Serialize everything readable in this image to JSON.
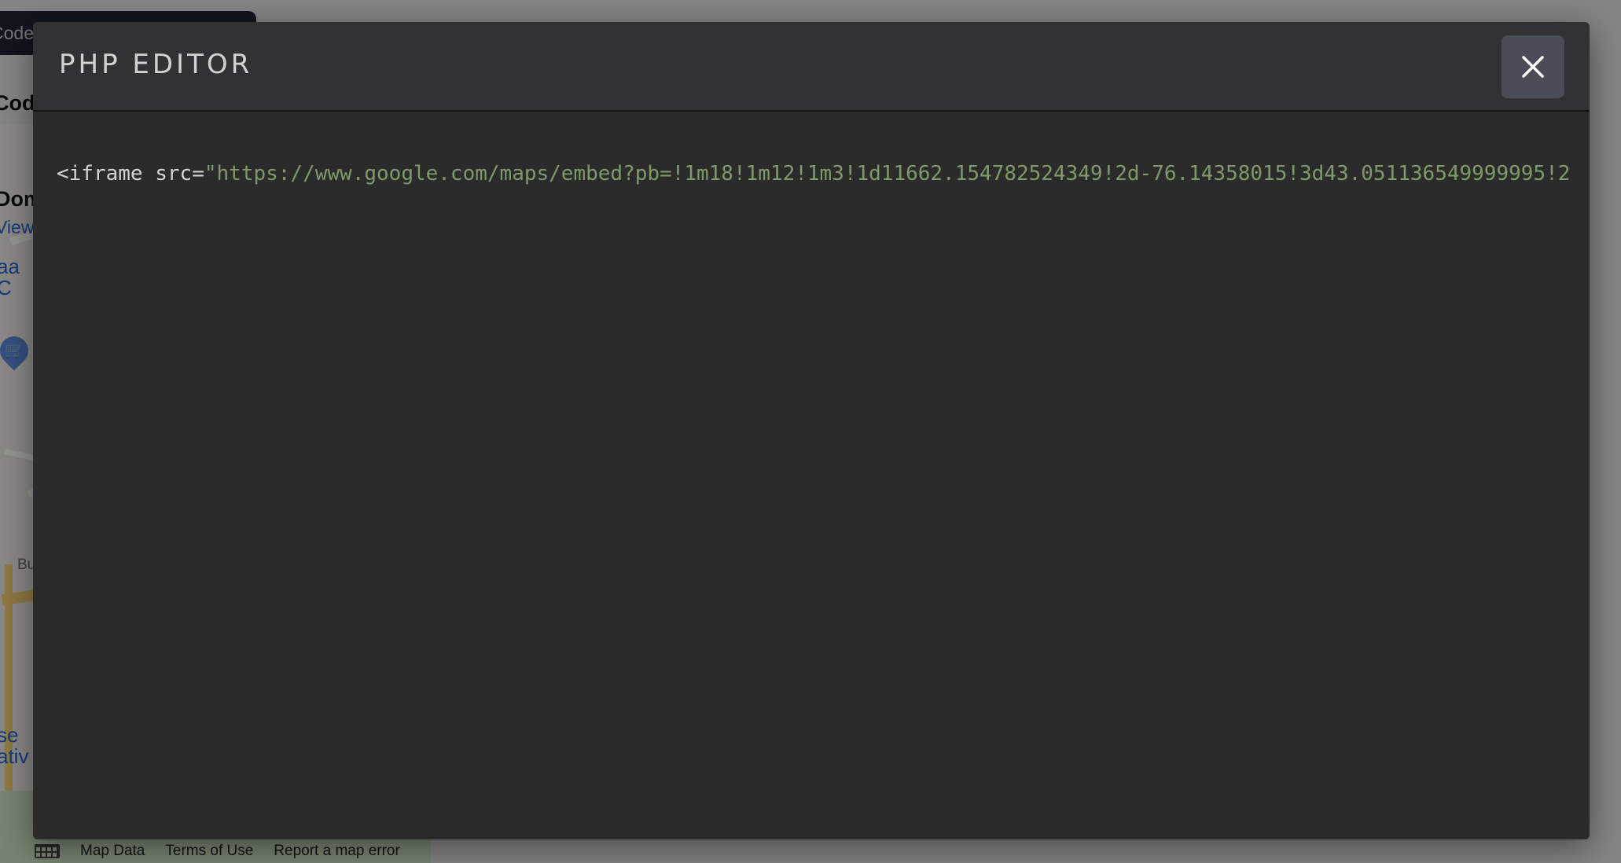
{
  "background": {
    "tab_label": "Code",
    "heading": "Code",
    "heading2": "Dom",
    "link_text": "View",
    "poi_1": [
      "aa",
      "C"
    ],
    "poi_2": [
      "se",
      "ativ"
    ],
    "street_label": "Bu",
    "map_attribution": {
      "map_data": "Map Data",
      "terms": "Terms of Use",
      "report": "Report a map error"
    }
  },
  "modal": {
    "title": "PHP EDITOR",
    "close_icon": "close-icon",
    "code": {
      "tag_open": "<iframe",
      "attr": " src=",
      "value": "\"https://www.google.com/maps/embed?pb=!1m18!1m12!1m3!1d11662.154782524349!2d-76.14358015!3d43.051136549999995!2"
    }
  },
  "colors": {
    "modal_bg": "#2b2b2b",
    "header_bg": "#323234",
    "close_button_bg": "#4a4d57",
    "string_token": "#7f9a6a",
    "tag_token": "#d4d4d4"
  }
}
